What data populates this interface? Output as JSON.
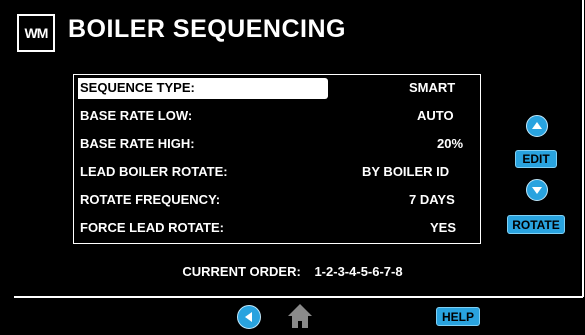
{
  "header": {
    "logo_text": "WM",
    "title": "BOILER SEQUENCING"
  },
  "settings": [
    {
      "label": "SEQUENCE TYPE:",
      "value": "SMART",
      "selected": true
    },
    {
      "label": "BASE RATE LOW:",
      "value": "AUTO",
      "selected": false
    },
    {
      "label": "BASE RATE HIGH:",
      "value": "20%",
      "selected": false
    },
    {
      "label": "LEAD BOILER ROTATE:",
      "value": "BY BOILER ID",
      "selected": false
    },
    {
      "label": "ROTATE FREQUENCY:",
      "value": "7 DAYS",
      "selected": false
    },
    {
      "label": "FORCE LEAD ROTATE:",
      "value": "YES",
      "selected": false
    }
  ],
  "controls": {
    "up_icon": "chevron-up-icon",
    "edit_label": "EDIT",
    "down_icon": "chevron-down-icon",
    "rotate_label": "ROTATE"
  },
  "current_order": {
    "label": "CURRENT ORDER:",
    "value": "1-2-3-4-5-6-7-8"
  },
  "footer": {
    "back_icon": "chevron-left-icon",
    "home_icon": "home-icon",
    "help_label": "HELP"
  },
  "colors": {
    "background": "#000000",
    "accent": "#29a3df",
    "text": "#ffffff"
  }
}
